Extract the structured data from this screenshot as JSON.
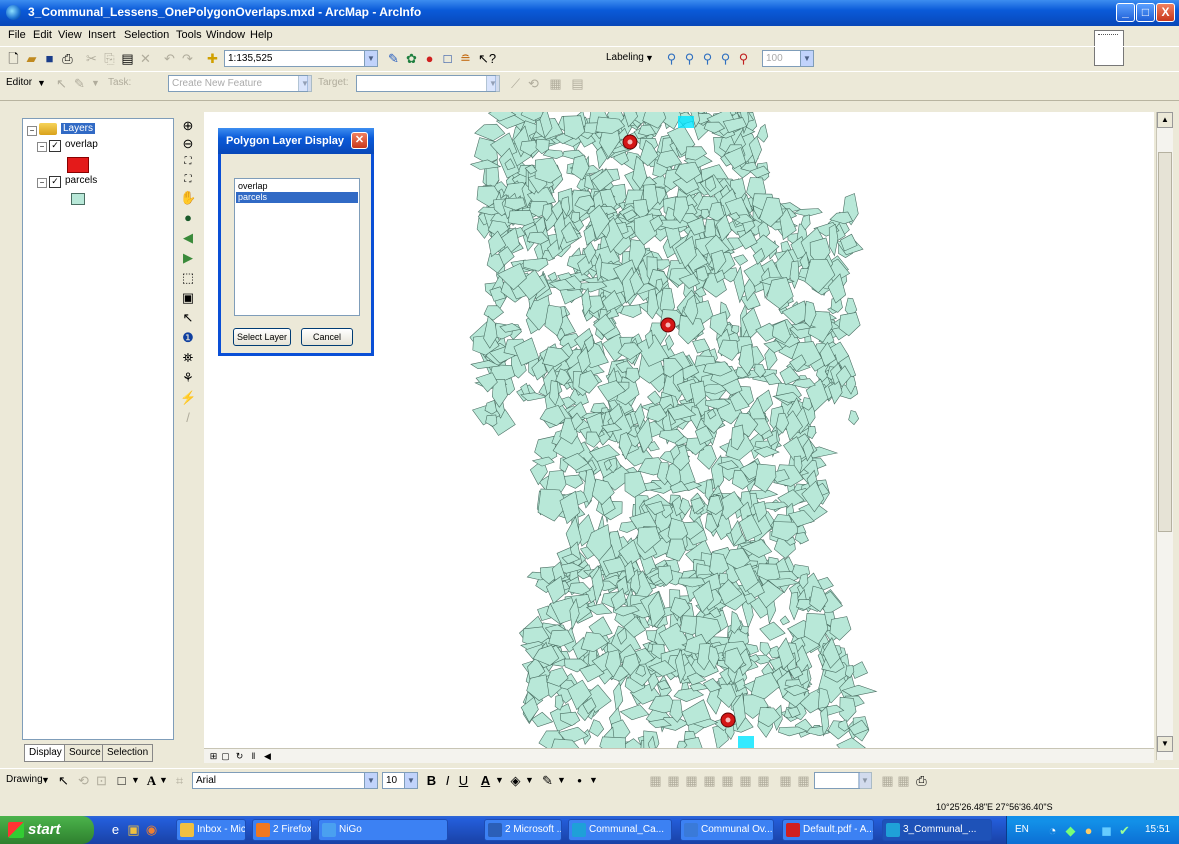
{
  "window": {
    "title": "3_Communal_Lessens_OnePolygonOverlaps.mxd - ArcMap - ArcInfo",
    "minimize": "_",
    "maximize": "□",
    "close": "X"
  },
  "menu": [
    "File",
    "Edit",
    "View",
    "Insert",
    "Selection",
    "Tools",
    "Window",
    "Help"
  ],
  "toolbar_standard": {
    "scale_value": "1:135,525",
    "layout_label": "Labeling",
    "layout_combo": "100"
  },
  "toolbar_editor": {
    "editor_label": "Editor",
    "task_label": "Task:",
    "task_value": "Create New Feature",
    "target_label": "Target:",
    "target_value": ""
  },
  "toc": {
    "root_label": "Layers",
    "layers": [
      {
        "name": "overlap",
        "checked": true,
        "swatch": "#e41a1a"
      },
      {
        "name": "parcels",
        "checked": true,
        "swatch": "#b8e8d8"
      }
    ],
    "tabs": [
      "Display",
      "Source",
      "Selection"
    ]
  },
  "dialog": {
    "title": "Polygon Layer Display",
    "items": [
      "overlap",
      "parcels"
    ],
    "selected_index": 1,
    "select_button": "Select Layer",
    "cancel_button": "Cancel"
  },
  "drawing_toolbar": {
    "drawing_label": "Drawing",
    "font_name": "Arial",
    "font_size": "10",
    "bold": "B",
    "italic": "I",
    "underline": "U"
  },
  "status": {
    "coordinates": "10°25'26.48\"E  27°56'36.40\"S"
  },
  "taskbar": {
    "start": "start",
    "tasks": [
      {
        "label": "Inbox - Microso...",
        "color": "#f0c040"
      },
      {
        "label": "2 Firefox",
        "color": "#f07820"
      },
      {
        "label": "NiGo",
        "color": "#4aa0f0"
      },
      {
        "label": "2 Microsoft ...",
        "color": "#2b5fb8"
      },
      {
        "label": "Communal_Ca...",
        "color": "#1fa0d8"
      },
      {
        "label": "Communal Ov...",
        "color": "#3a7ad8"
      },
      {
        "label": "Default.pdf - A...",
        "color": "#d02020"
      },
      {
        "label": "3_Communal_...",
        "color": "#1fa0d8"
      }
    ],
    "tray_language": "EN",
    "clock": "15:51"
  },
  "map": {
    "polygon_fill": "#b8e8d8",
    "polygon_stroke": "#4a6e62",
    "overlap_color": "#d41616",
    "selection_color": "#00e5ff"
  }
}
